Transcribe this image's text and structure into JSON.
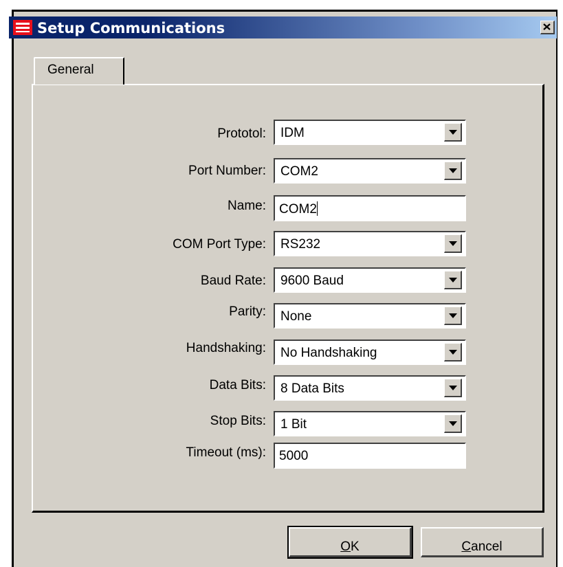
{
  "window": {
    "title": "Setup Communications",
    "close_label": "X"
  },
  "tabs": [
    {
      "label": "General",
      "selected": true
    }
  ],
  "fields": {
    "protocol": {
      "label": "Prototol:",
      "value": "IDM"
    },
    "port_number": {
      "label": "Port Number:",
      "value": "COM2"
    },
    "name": {
      "label": "Name:",
      "value": "COM2"
    },
    "com_port_type": {
      "label": "COM Port Type:",
      "value": "RS232"
    },
    "baud_rate": {
      "label": "Baud Rate:",
      "value": "9600 Baud"
    },
    "parity": {
      "label": "Parity:",
      "value": "None"
    },
    "handshaking": {
      "label": "Handshaking:",
      "value": "No Handshaking"
    },
    "data_bits": {
      "label": "Data Bits:",
      "value": "8 Data Bits"
    },
    "stop_bits": {
      "label": "Stop Bits:",
      "value": "1 Bit"
    },
    "timeout": {
      "label": "Timeout (ms):",
      "value": "5000"
    }
  },
  "buttons": {
    "ok": {
      "mnemonic": "O",
      "rest": "K"
    },
    "cancel": {
      "mnemonic": "C",
      "rest": "ancel"
    }
  },
  "icons": {
    "app": "app-icon",
    "close": "close-icon",
    "dropdown": "chevron-down-icon"
  },
  "colors": {
    "titlebar_start": "#0a246a",
    "titlebar_end": "#a6caf0",
    "dialog_bg": "#d4d0c8",
    "app_icon": "#e8101c"
  }
}
